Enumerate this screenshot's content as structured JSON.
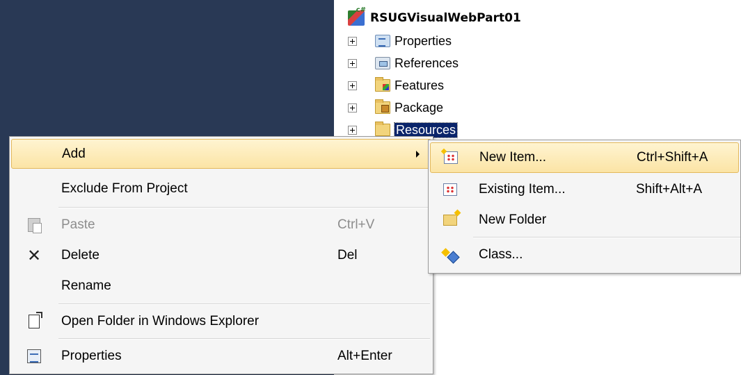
{
  "colors": {
    "editor_background": "#293955",
    "menu_background": "#f5f5f5",
    "highlight_fill": "#fbe4a5",
    "highlight_border": "#e3b85c",
    "selection": "#0a246a"
  },
  "solution_explorer": {
    "project": {
      "label": "RSUGVisualWebPart01",
      "icon": "csharp-project-icon",
      "icon_badge": "c#"
    },
    "items": [
      {
        "label": "Properties",
        "icon": "properties-icon",
        "expander": "+"
      },
      {
        "label": "References",
        "icon": "references-icon",
        "expander": "+"
      },
      {
        "label": "Features",
        "icon": "features-folder-icon",
        "expander": "+"
      },
      {
        "label": "Package",
        "icon": "package-folder-icon",
        "expander": "+"
      },
      {
        "label": "Resources",
        "icon": "folder-icon",
        "expander": "+",
        "selected": true
      }
    ]
  },
  "context_menu": {
    "items": [
      {
        "label": "Add",
        "shortcut": "",
        "icon": "",
        "highlighted": true,
        "has_submenu": true
      },
      {
        "label": "Exclude From Project",
        "shortcut": "",
        "icon": ""
      },
      {
        "label": "Paste",
        "shortcut": "Ctrl+V",
        "icon": "paste-icon",
        "disabled": true
      },
      {
        "label": "Delete",
        "shortcut": "Del",
        "icon": "delete-icon",
        "glyph": "✕"
      },
      {
        "label": "Rename",
        "shortcut": "",
        "icon": ""
      },
      {
        "label": "Open Folder in Windows Explorer",
        "shortcut": "",
        "icon": "open-folder-icon"
      },
      {
        "label": "Properties",
        "shortcut": "Alt+Enter",
        "icon": "properties-icon"
      }
    ]
  },
  "add_submenu": {
    "items": [
      {
        "label": "New Item...",
        "shortcut": "Ctrl+Shift+A",
        "icon": "new-item-icon",
        "highlighted": true
      },
      {
        "label": "Existing Item...",
        "shortcut": "Shift+Alt+A",
        "icon": "existing-item-icon"
      },
      {
        "label": "New Folder",
        "shortcut": "",
        "icon": "new-folder-icon"
      },
      {
        "label": "Class...",
        "shortcut": "",
        "icon": "class-icon"
      }
    ]
  }
}
